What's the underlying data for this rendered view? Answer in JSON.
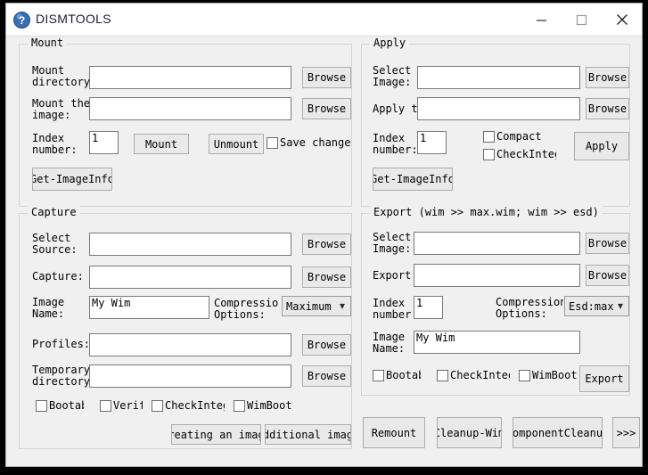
{
  "window": {
    "title": "DISMTOOLS",
    "icon": "help-circle-icon",
    "minimize_label": "—",
    "maximize_label": "□",
    "close_label": "✕"
  },
  "mount": {
    "title": "Mount",
    "mount_directory_label": "Mount\ndirectory:",
    "mount_directory_value": "",
    "mount_directory_browse": "Browse",
    "mount_image_label": "Mount the\nimage:",
    "mount_image_value": "",
    "mount_image_browse": "Browse",
    "index_label": "Index\nnumber:",
    "index_value": "1",
    "mount_button": "Mount",
    "unmount_button": "Unmount",
    "save_changes_label": "Save changes",
    "get_imageinfo_button": "Get-ImageInfo"
  },
  "apply": {
    "title": "Apply",
    "select_image_label": "Select\nImage:",
    "select_image_value": "",
    "select_image_browse": "Browse",
    "apply_to_label": "Apply to",
    "apply_to_value": "",
    "apply_to_browse": "Browse",
    "index_label": "Index\nnumber:",
    "index_value": "1",
    "compact_label": "Compact",
    "checkintegrity_label": "CheckIntegrity",
    "apply_button": "Apply",
    "get_imageinfo_button": "Get-ImageInfo"
  },
  "capture": {
    "title": "Capture",
    "select_source_label": "Select\nSource:",
    "select_source_value": "",
    "select_source_browse": "Browse",
    "capture_label": "Capture:",
    "capture_value": "",
    "capture_browse": "Browse",
    "image_name_label": "Image\nName:",
    "image_name_value": "My Wim",
    "compression_label": "Compression\nOptions:",
    "compression_value": "Maximum",
    "profiles_label": "Profiles:",
    "profiles_value": "",
    "profiles_browse": "Browse",
    "temp_dir_label": "Temporary\ndirectory:",
    "temp_dir_value": "",
    "temp_dir_browse": "Browse",
    "bootable_label": "Bootable",
    "verify_label": "Verify",
    "checkintegrity_label": "CheckIntegrity",
    "wimboot_label": "WimBoot",
    "creating_button": "Creating an image",
    "additional_button": "Additional image"
  },
  "export": {
    "title": "Export (wim >> max.wim; wim >> esd)",
    "select_image_label": "Select\nImage:",
    "select_image_value": "",
    "select_image_browse": "Browse",
    "export_to_label": "Export to",
    "export_to_value": "",
    "export_to_browse": "Browse",
    "index_label": "Index\nnumber:",
    "index_value": "1",
    "compression_label": "Compression\nOptions:",
    "compression_value": "Esd:max",
    "image_name_label": "Image\nName:",
    "image_name_value": "My Wim",
    "bootable_label": "Bootable",
    "checkintegrity_label": "CheckIntegrity",
    "wimboot_label": "WimBoot",
    "export_button": "Export"
  },
  "bottom": {
    "remount_button": "Remount",
    "cleanup_wim_button": "Cleanup-Wim",
    "component_cleanup_button": "ComponentCleanup",
    "more_button": ">>>"
  },
  "colors": {
    "window_bg": "#f0f0f0",
    "titlebar_bg": "#ffffff",
    "icon_blue": "#2b5fa8",
    "text": "#000000",
    "button_face": "#e9e9e9",
    "border": "#adadad"
  }
}
